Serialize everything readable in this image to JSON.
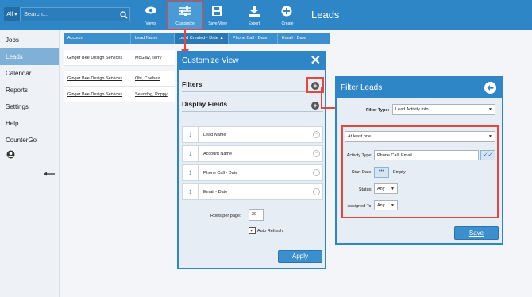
{
  "header": {
    "scope": "All",
    "search_placeholder": "Search...",
    "title": "Leads",
    "tools": [
      {
        "label": "Views",
        "icon": "eye-icon"
      },
      {
        "label": "Customize",
        "icon": "sliders-icon"
      },
      {
        "label": "Save View",
        "icon": "save-icon"
      },
      {
        "label": "Export",
        "icon": "download-icon"
      },
      {
        "label": "Create",
        "icon": "plus-circle-icon"
      }
    ]
  },
  "sidebar": {
    "items": [
      {
        "label": "Jobs"
      },
      {
        "label": "Leads"
      },
      {
        "label": "Calendar"
      },
      {
        "label": "Reports"
      },
      {
        "label": "Settings"
      },
      {
        "label": "Help"
      },
      {
        "label": "CounterGo"
      }
    ]
  },
  "table": {
    "columns": [
      "Account",
      "Lead Name",
      "Lead Created - Date ▲",
      "Phone Call - Date",
      "Email - Date"
    ],
    "rows": [
      {
        "account": "Ginger Bee Design Services",
        "lead": "McGaw, Terry"
      },
      {
        "account": "Ginger Bee Design Services",
        "lead": "Obi, Chelsea"
      },
      {
        "account": "Ginger Bee Design Services",
        "lead": "Seeddog, Poppy"
      }
    ]
  },
  "customize": {
    "title": "Customize View",
    "filters_label": "Filters",
    "display_label": "Display Fields",
    "fields": [
      "Lead Name",
      "Account Name",
      "Phone Call - Date",
      "Email - Date"
    ],
    "rows_label": "Rows per page:",
    "rows_value": "30",
    "auto_refresh_label": "Auto Refresh",
    "apply_label": "Apply"
  },
  "filter": {
    "title": "Filter Leads",
    "type_label": "Filter Type:",
    "type_value": "Lead Activity Info",
    "match_value": "At least one",
    "activity_label": "Activity Type:",
    "activity_value": "Phone Call, Email",
    "start_label": "Start Date:",
    "start_value": "Empty",
    "status_label": "Status:",
    "status_value": "Any",
    "assigned_label": "Assigned To:",
    "assigned_value": "Any",
    "save_label": "Save"
  },
  "colors": {
    "accent": "#2f86c7",
    "highlight": "#e5473d"
  }
}
